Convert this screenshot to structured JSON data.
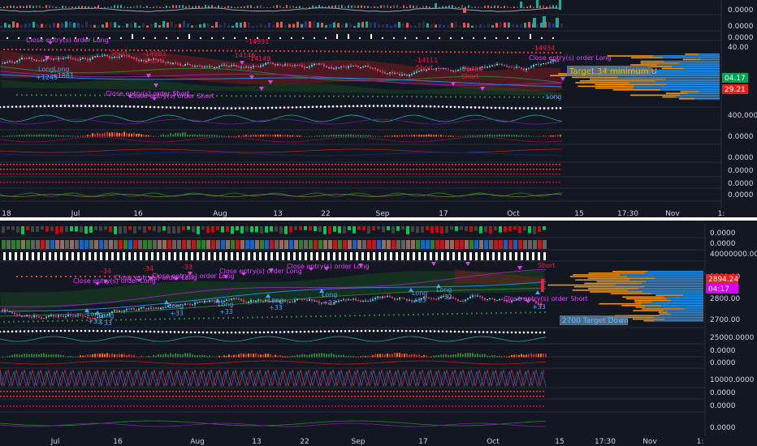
{
  "colors": {
    "bg": "#131722",
    "grid": "#1f2432",
    "separator": "#ffffff",
    "up": "#26a69a",
    "down": "#ef5350",
    "pink": "#e040fb",
    "red_text": "#ff1744",
    "blue_text": "#42a5f5",
    "orange": "#ff9800",
    "blue_bar": "#2196f3",
    "label_box": "#5d7a99",
    "green_tag": "#00a152",
    "red_tag": "#e91e1e",
    "magenta_tag": "#d500f9"
  },
  "top": {
    "x_labels": [
      {
        "text": "18",
        "x": 8
      },
      {
        "text": "Jul",
        "x": 93
      },
      {
        "text": "16",
        "x": 170
      },
      {
        "text": "Aug",
        "x": 271
      },
      {
        "text": "13",
        "x": 342
      },
      {
        "text": "22",
        "x": 401
      },
      {
        "text": "Sep",
        "x": 471
      },
      {
        "text": "17",
        "x": 546
      },
      {
        "text": "Oct",
        "x": 632
      },
      {
        "text": "15",
        "x": 713
      },
      {
        "text": "17:30",
        "x": 773
      },
      {
        "text": "Nov",
        "x": 828
      },
      {
        "text": "1:",
        "x": 888
      }
    ],
    "y_labels": [
      {
        "text": "0.0000",
        "y": 12
      },
      {
        "text": "0.0000",
        "y": 32
      },
      {
        "text": "0.0000",
        "y": 46
      },
      {
        "text": "40.00",
        "y": 58
      },
      {
        "text": "400.0000",
        "y": 142
      },
      {
        "text": "0.0000",
        "y": 168
      },
      {
        "text": "0.0000",
        "y": 194
      },
      {
        "text": "0.0000",
        "y": 210
      },
      {
        "text": "0.0000",
        "y": 226
      },
      {
        "text": "0.0000",
        "y": 240
      }
    ],
    "price_tags": [
      {
        "text": "04.17",
        "y": 96,
        "color": "green"
      },
      {
        "text": "29.21",
        "y": 110,
        "color": "red"
      }
    ],
    "target_label": "Target 34 minimum U",
    "annotations": [
      {
        "text": "Close entry(s) order Long",
        "x": 32,
        "y": 52,
        "color": "pink"
      },
      {
        "text": "Long",
        "x": 47,
        "y": 88,
        "color": "blue"
      },
      {
        "text": "Long",
        "x": 66,
        "y": 88,
        "color": "blue"
      },
      {
        "text": "+1245",
        "x": 44,
        "y": 98,
        "color": "blue"
      },
      {
        "text": "+1881",
        "x": 64,
        "y": 96,
        "color": "blue"
      },
      {
        "text": "Short",
        "x": 136,
        "y": 68,
        "color": "red"
      },
      {
        "text": "-14983",
        "x": 176,
        "y": 69,
        "color": "red"
      },
      {
        "text": "Short",
        "x": 178,
        "y": 78,
        "color": "red"
      },
      {
        "text": "Close entry(s) order Short",
        "x": 130,
        "y": 118,
        "color": "pink"
      },
      {
        "text": "Close entry(s) order Short",
        "x": 160,
        "y": 121,
        "color": "pink"
      },
      {
        "text": "-14931",
        "x": 303,
        "y": 54,
        "color": "red"
      },
      {
        "text": "-14146",
        "x": 286,
        "y": 71,
        "color": "red"
      },
      {
        "text": "-14149",
        "x": 305,
        "y": 75,
        "color": "red"
      },
      {
        "text": "-14111",
        "x": 511,
        "y": 77,
        "color": "red"
      },
      {
        "text": "Short",
        "x": 512,
        "y": 86,
        "color": "red"
      },
      {
        "text": "-16484",
        "x": 566,
        "y": 88,
        "color": "red"
      },
      {
        "text": "Short",
        "x": 568,
        "y": 97,
        "color": "red"
      },
      {
        "text": "-14934",
        "x": 655,
        "y": 62,
        "color": "red"
      },
      {
        "text": "Close entry(s) order Long",
        "x": 651,
        "y": 74,
        "color": "pink"
      },
      {
        "text": "Long",
        "x": 672,
        "y": 122,
        "color": "blue"
      }
    ]
  },
  "bottom": {
    "x_labels": [
      {
        "text": "Jul",
        "x": 68
      },
      {
        "text": "16",
        "x": 145
      },
      {
        "text": "Aug",
        "x": 243
      },
      {
        "text": "13",
        "x": 316
      },
      {
        "text": "22",
        "x": 375
      },
      {
        "text": "Sep",
        "x": 441
      },
      {
        "text": "17",
        "x": 521
      },
      {
        "text": "Oct",
        "x": 607
      },
      {
        "text": "15",
        "x": 689
      },
      {
        "text": "17:30",
        "x": 745
      },
      {
        "text": "Nov",
        "x": 800
      },
      {
        "text": "1:",
        "x": 862
      }
    ],
    "y_labels": [
      {
        "text": "0.0000",
        "y": 287
      },
      {
        "text": "0.0000",
        "y": 300
      },
      {
        "text": "40000000.0000",
        "y": 313
      },
      {
        "text": "2900.00",
        "y": 341
      },
      {
        "text": "2800.00",
        "y": 368
      },
      {
        "text": "2700.00",
        "y": 394
      },
      {
        "text": "25000.0000",
        "y": 416
      },
      {
        "text": "0.0000",
        "y": 432
      },
      {
        "text": "0.0000",
        "y": 447
      },
      {
        "text": "10000.0000",
        "y": 468
      },
      {
        "text": "0.0000",
        "y": 484
      },
      {
        "text": "0.0000",
        "y": 500
      },
      {
        "text": "0.0000",
        "y": 527
      }
    ],
    "price_tags": [
      {
        "text": "2894.24",
        "y": 344,
        "color": "red"
      },
      {
        "text": "04:17",
        "y": 356,
        "color": "magenta"
      }
    ],
    "target_label": "2700 Target Down",
    "annotations": [
      {
        "text": "-34",
        "x": 124,
        "y": 337,
        "color": "red"
      },
      {
        "text": "-34",
        "x": 176,
        "y": 334,
        "color": "red"
      },
      {
        "text": "-33",
        "x": 224,
        "y": 332,
        "color": "red"
      },
      {
        "text": "Close entry(s) order Long",
        "x": 353,
        "y": 331,
        "color": "pink"
      },
      {
        "text": "Close entry(s) order Long",
        "x": 270,
        "y": 337,
        "color": "pink"
      },
      {
        "text": "Close entry(s) order Long",
        "x": 90,
        "y": 349,
        "color": "pink"
      },
      {
        "text": "Close entry(s) order Long",
        "x": 141,
        "y": 345,
        "color": "pink"
      },
      {
        "text": "Close entry(s) order Long",
        "x": 187,
        "y": 343,
        "color": "pink"
      },
      {
        "text": "Long",
        "x": 107,
        "y": 390,
        "color": "blue"
      },
      {
        "text": "+33",
        "x": 108,
        "y": 399,
        "color": "blue"
      },
      {
        "text": "Long",
        "x": 121,
        "y": 392,
        "color": "blue"
      },
      {
        "text": "+33",
        "x": 121,
        "y": 401,
        "color": "blue"
      },
      {
        "text": "Long",
        "x": 207,
        "y": 380,
        "color": "blue"
      },
      {
        "text": "+33",
        "x": 209,
        "y": 389,
        "color": "blue"
      },
      {
        "text": "Long",
        "x": 268,
        "y": 378,
        "color": "blue"
      },
      {
        "text": "+33",
        "x": 270,
        "y": 387,
        "color": "blue"
      },
      {
        "text": "Long",
        "x": 330,
        "y": 373,
        "color": "blue"
      },
      {
        "text": "+33",
        "x": 331,
        "y": 382,
        "color": "blue"
      },
      {
        "text": "Long",
        "x": 396,
        "y": 366,
        "color": "blue"
      },
      {
        "text": "+33",
        "x": 397,
        "y": 376,
        "color": "blue"
      },
      {
        "text": "Long",
        "x": 507,
        "y": 364,
        "color": "blue"
      },
      {
        "text": "+33",
        "x": 508,
        "y": 373,
        "color": "blue"
      },
      {
        "text": "Long",
        "x": 537,
        "y": 360,
        "color": "blue"
      },
      {
        "text": "+32",
        "x": 540,
        "y": 369,
        "color": "blue"
      },
      {
        "text": "Close entry(s) order Short",
        "x": 620,
        "y": 371,
        "color": "pink"
      },
      {
        "text": "+33",
        "x": 655,
        "y": 381,
        "color": "blue"
      },
      {
        "text": "Short",
        "x": 662,
        "y": 330,
        "color": "red"
      }
    ]
  },
  "chart_data": [
    {
      "type": "line",
      "panel": "top",
      "y_axis_ticks": [
        "40.00",
        "400.0000"
      ],
      "x_ticks": [
        "18",
        "Jul",
        "16",
        "Aug",
        "13",
        "22",
        "Sep",
        "17",
        "Oct",
        "15",
        "17:30",
        "Nov"
      ]
    },
    {
      "type": "line",
      "panel": "bottom",
      "y_axis_ticks": [
        "2900.00",
        "2800.00",
        "2700.00"
      ],
      "x_ticks": [
        "Jul",
        "16",
        "Aug",
        "13",
        "22",
        "Sep",
        "17",
        "Oct",
        "15",
        "17:30",
        "Nov"
      ],
      "last_price": "2894.24"
    }
  ]
}
